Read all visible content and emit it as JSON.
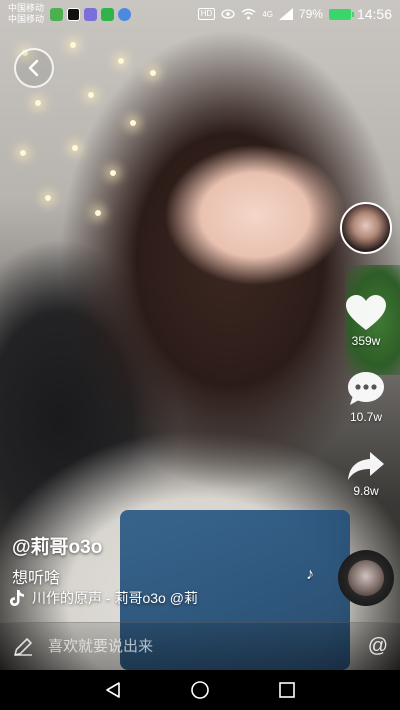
{
  "status_bar": {
    "carrier_1": "中国移动",
    "carrier_2": "中国移动",
    "network": "4G",
    "battery": "79%",
    "time": "14:56"
  },
  "video": {
    "author": "@莉哥o3o",
    "caption": "想听啥",
    "music_text": "川作的原声 - 莉哥o3o  @莉"
  },
  "actions": {
    "likes": "359w",
    "comments": "10.7w",
    "shares": "9.8w"
  },
  "comment_bar": {
    "placeholder": "喜欢就要说出来",
    "at_symbol": "@"
  },
  "colors": {
    "battery": "#3bd66b",
    "white": "#ffffff"
  }
}
